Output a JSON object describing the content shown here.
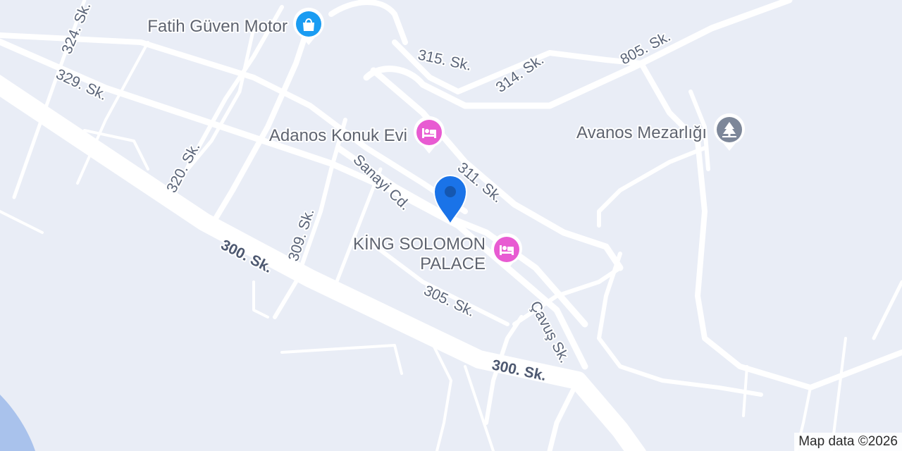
{
  "map": {
    "colors": {
      "land": "#e9edf6",
      "road": "#ffffff",
      "water": "#a9c2ec",
      "pin": "#1a73e8",
      "pin_dot": "#1557b0",
      "lodging": "#e85bd2",
      "shopping": "#1a9cf2",
      "cemetery": "#7d8799",
      "street_label": "#5a6478"
    },
    "streets": [
      {
        "name": "324. Sk."
      },
      {
        "name": "329. Sk."
      },
      {
        "name": "320. Sk."
      },
      {
        "name": "315. Sk."
      },
      {
        "name": "314. Sk."
      },
      {
        "name": "805. Sk."
      },
      {
        "name": "311. Sk."
      },
      {
        "name": "Sanayi Cd."
      },
      {
        "name": "309. Sk."
      },
      {
        "name": "300. Sk."
      },
      {
        "name": "305. Sk."
      },
      {
        "name": "Çavuş Sk."
      },
      {
        "name": "300. Sk."
      }
    ],
    "pois": [
      {
        "name": "Fatih Güven Motor",
        "category": "shopping",
        "icon": "shopping-bag-icon"
      },
      {
        "name": "Adanos Konuk Evi",
        "category": "lodging",
        "icon": "bed-icon"
      },
      {
        "name": "Avanos Mezarlığı",
        "category": "cemetery",
        "icon": "tree-icon"
      },
      {
        "name_lines": [
          "KİNG SOLOMON",
          "PALACE"
        ],
        "category": "lodging",
        "icon": "bed-icon"
      }
    ],
    "selected_pin": {
      "icon": "location-pin-icon"
    },
    "attribution": "Map data ©2026"
  }
}
